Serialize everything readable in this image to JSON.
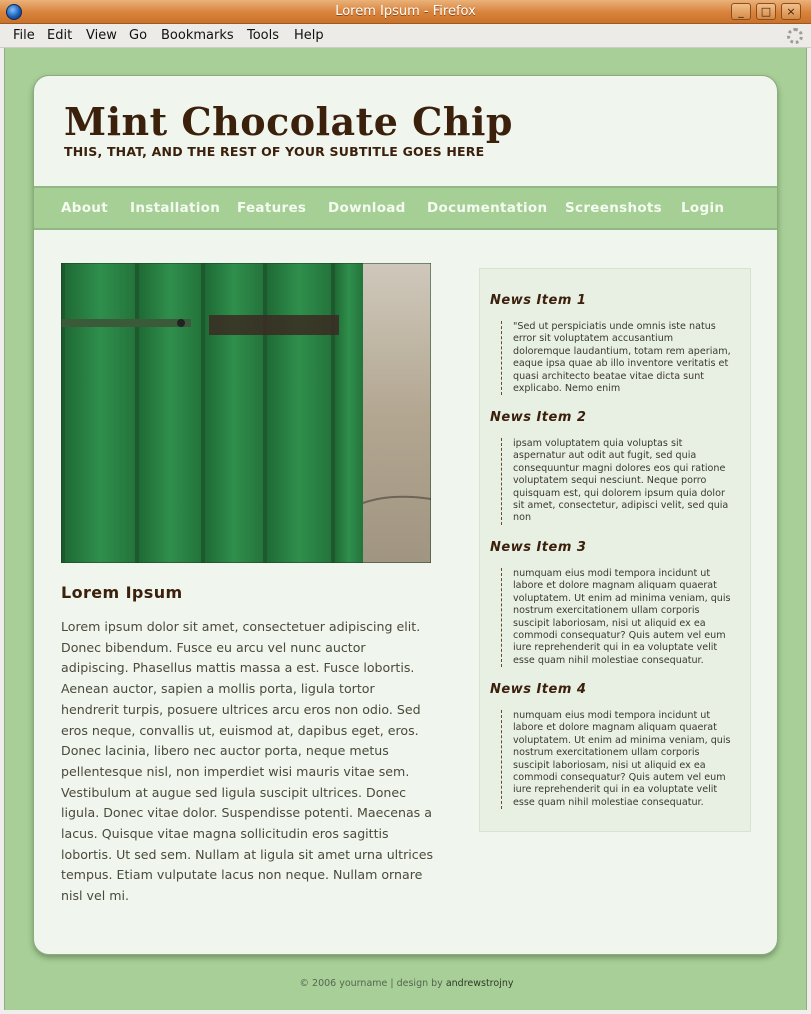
{
  "window": {
    "title": "Lorem Ipsum - Firefox",
    "buttons": [
      "_",
      "□",
      "×"
    ]
  },
  "menu": [
    "File",
    "Edit",
    "View",
    "Go",
    "Bookmarks",
    "Tools",
    "Help"
  ],
  "site": {
    "title": "Mint Chocolate Chip",
    "subtitle": "THIS, THAT, AND THE REST OF YOUR SUBTITLE GOES HERE",
    "nav": [
      "About",
      "Installation",
      "Features",
      "Download",
      "Documentation",
      "Screenshots",
      "Login"
    ]
  },
  "article": {
    "title": "Lorem Ipsum",
    "body": "Lorem ipsum dolor sit amet, consectetuer adipiscing elit. Donec bibendum. Fusce eu arcu vel nunc auctor adipiscing. Phasellus mattis massa a est. Fusce lobortis. Aenean auctor, sapien a mollis porta, ligula tortor hendrerit turpis, posuere ultrices arcu eros non odio. Sed eros neque, convallis ut, euismod at, dapibus eget, eros. Donec lacinia, libero nec auctor porta, neque metus pellentesque nisl, non imperdiet wisi mauris vitae sem. Vestibulum at augue sed ligula suscipit ultrices. Donec ligula. Donec vitae dolor. Suspendisse potenti. Maecenas a lacus. Quisque vitae magna sollicitudin eros sagittis lobortis. Ut sed sem. Nullam at ligula sit amet urna ultrices tempus. Etiam vulputate lacus non neque. Nullam ornare nisl vel mi."
  },
  "news": [
    {
      "title": "News Item 1",
      "body": "\"Sed ut perspiciatis unde omnis iste natus error sit voluptatem accusantium doloremque laudantium, totam rem aperiam, eaque ipsa quae ab illo inventore veritatis et quasi architecto beatae vitae dicta sunt explicabo. Nemo enim"
    },
    {
      "title": "News Item 2",
      "body": "ipsam voluptatem quia voluptas sit aspernatur aut odit aut fugit, sed quia consequuntur magni dolores eos qui ratione voluptatem sequi nesciunt. Neque porro quisquam est, qui dolorem ipsum quia dolor sit amet, consectetur, adipisci velit, sed quia non"
    },
    {
      "title": "News Item 3",
      "body": "numquam eius modi tempora incidunt ut labore et dolore magnam aliquam quaerat voluptatem. Ut enim ad minima veniam, quis nostrum exercitationem ullam corporis suscipit laboriosam, nisi ut aliquid ex ea commodi consequatur? Quis autem vel eum iure reprehenderit qui in ea voluptate velit esse quam nihil molestiae consequatur."
    },
    {
      "title": "News Item 4",
      "body": "numquam eius modi tempora incidunt ut labore et dolore magnam aliquam quaerat voluptatem. Ut enim ad minima veniam, quis nostrum exercitationem ullam corporis suscipit laboriosam, nisi ut aliquid ex ea commodi consequatur? Quis autem vel eum iure reprehenderit qui in ea voluptate velit esse quam nihil molestiae consequatur."
    }
  ],
  "footer": {
    "text": "© 2006 yourname | design by",
    "credit": "andrewstrojny"
  },
  "colors": {
    "background": "#a8cf98",
    "card": "#f0f5ee",
    "nav": "#a6cf96",
    "heading": "#3b200c"
  }
}
